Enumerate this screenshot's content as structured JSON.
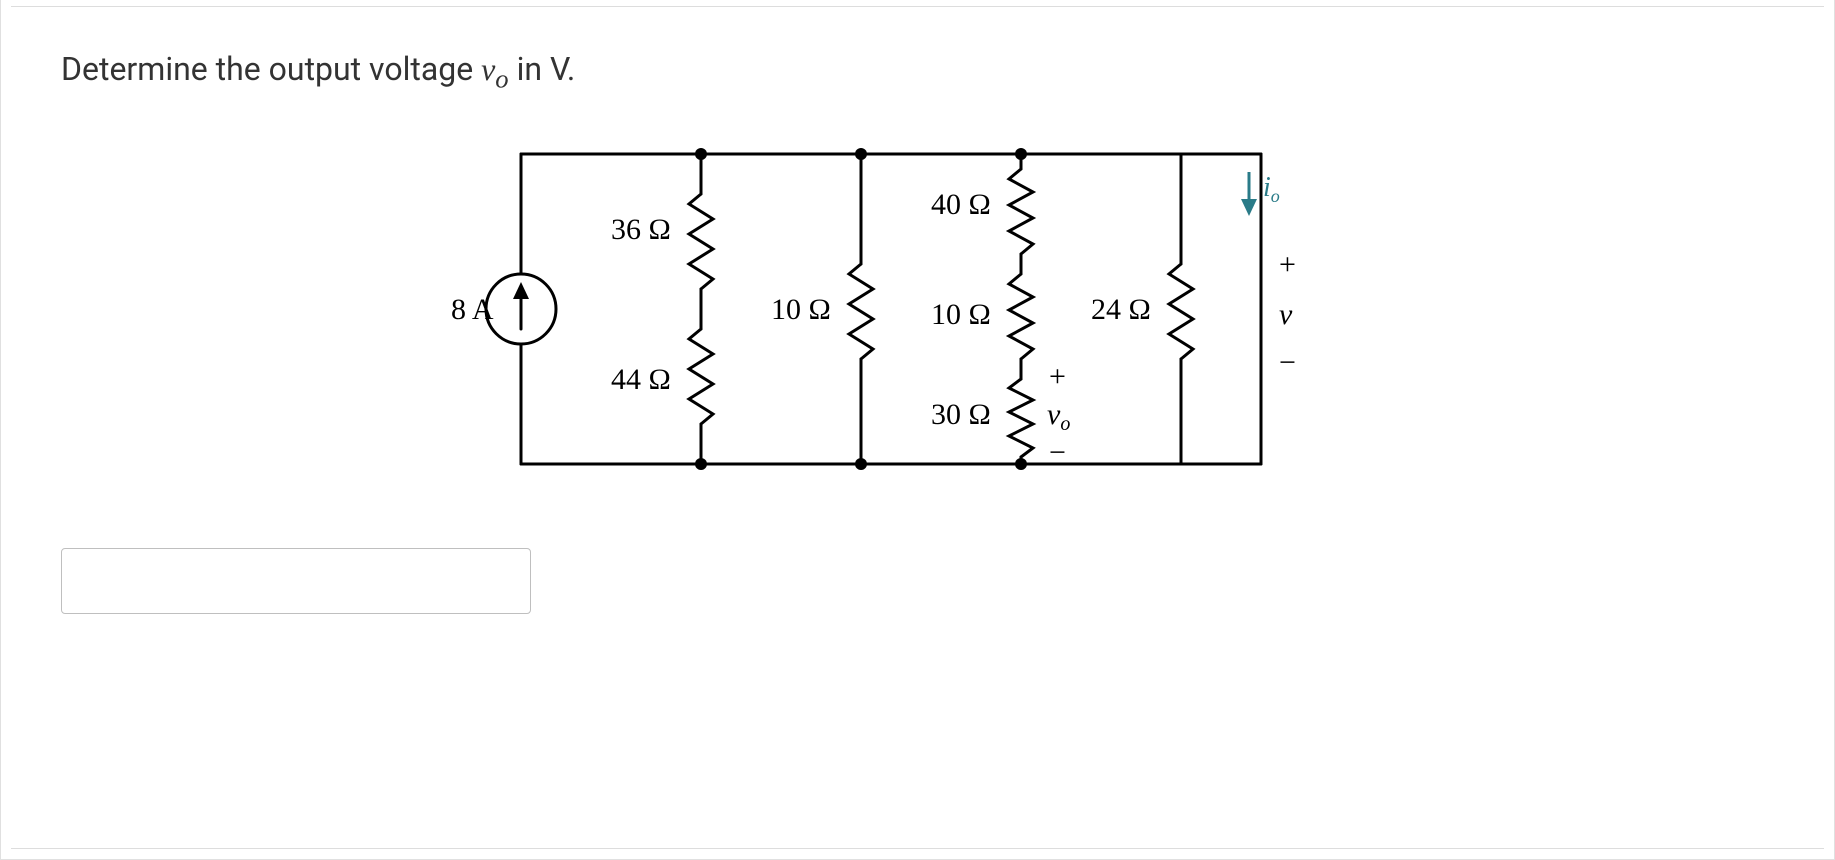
{
  "question": {
    "lead": "Determine the output voltage ",
    "var": "v",
    "sub": "o",
    "tail": " in V."
  },
  "circuit": {
    "source": {
      "value": "8 A"
    },
    "resistors": {
      "r36": "36 Ω",
      "r44": "44 Ω",
      "r10a": "10 Ω",
      "r40": "40 Ω",
      "r10b": "10 Ω",
      "r30": "30 Ω",
      "r24": "24 Ω"
    },
    "io": {
      "label_i": "i",
      "label_sub": "o"
    },
    "v": {
      "plus": "+",
      "minus": "−",
      "name": "v"
    },
    "vo": {
      "plus": "+",
      "minus": "−",
      "name": "v",
      "sub": "o"
    }
  },
  "answer_placeholder": ""
}
